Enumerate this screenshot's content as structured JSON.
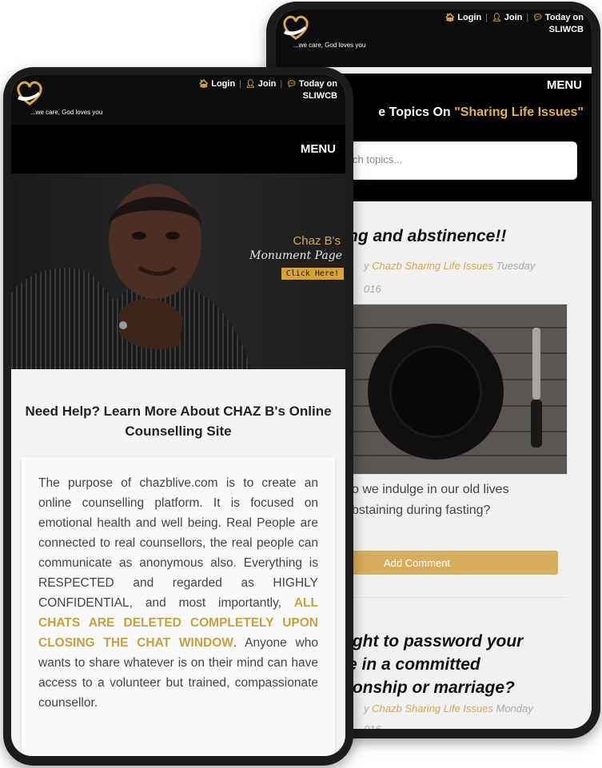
{
  "back": {
    "tagline": "...we care, God loves you",
    "links": {
      "login": "Login",
      "join": "Join",
      "today_line1": "Today on",
      "today_line2": "SLIWCB"
    },
    "menu": "MENU",
    "topics_prefix": "e Topics On ",
    "topics_highlight": "\"Sharing Life Issues\"",
    "search_placeholder": "ch topics...",
    "post1": {
      "title": "ng and abstinence!!",
      "meta_prefix": "y ",
      "author": "Chazb Sharing Life Issues",
      "meta_date": " Tuesday",
      "meta_year": "016",
      "excerpt_line1": "o we indulge in our old lives",
      "excerpt_line2": "bstaining during fasting?",
      "button": "Add Comment"
    },
    "post2": {
      "title_line1": "ight to password your",
      "title_line2": "e in a committed",
      "title_line3": "ionship or marriage?",
      "meta_prefix": "y ",
      "author": "Chazb Sharing Life Issues",
      "meta_date": " Monday",
      "meta_year": "016"
    }
  },
  "front": {
    "tagline": "...we care, God loves you",
    "links": {
      "login": "Login",
      "join": "Join",
      "today_line1": "Today on",
      "today_line2": "SLIWCB"
    },
    "menu": "MENU",
    "hero": {
      "title": "Chaz B's",
      "subtitle": "Monument Page",
      "button": "Click Here!"
    },
    "heading": "Need Help? Learn More About CHAZ B's Online Counselling Site",
    "body_part1": "The purpose of chazblive.com is to create an online counselling platform. It is focused on emotional health and well being. Real People are connected to real counsellors, the real people can communicate as anonymous also. Everything is RESPECTED and regarded as HIGHLY CONFIDENTIAL, and most importantly, ",
    "body_highlight": "ALL CHATS ARE DELETED COMPLETELY UPON CLOSING THE CHAT WINDOW",
    "body_part2": ". Anyone who wants to share whatever is on their mind can have access to a volunteer but trained, compassionate counsellor."
  },
  "colors": {
    "gold": "#d4a84b",
    "black": "#000000",
    "button_gold": "#d6ad5c"
  },
  "icons": [
    "home-icon",
    "user-icon",
    "chat-icon",
    "heart-hand-logo"
  ]
}
